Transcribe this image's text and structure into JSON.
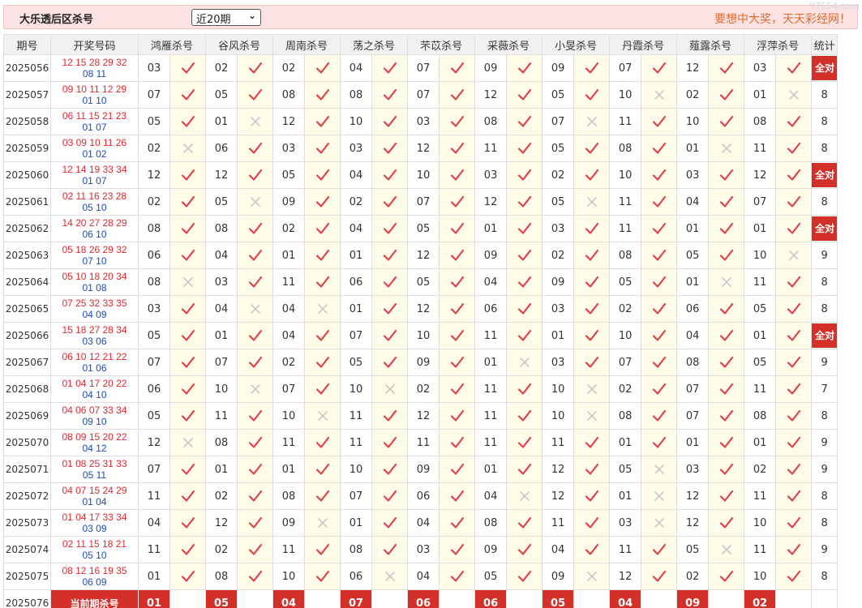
{
  "header": {
    "title": "大乐透后区杀号",
    "period_select": "近20期",
    "slogan": "要想中大奖，天天彩经网！",
    "watermark": "97654.com"
  },
  "table": {
    "columns": [
      "期号",
      "开奖号码",
      "鸿雁杀号",
      "谷风杀号",
      "周南杀号",
      "荡之杀号",
      "芣苡杀号",
      "采薇杀号",
      "小旻杀号",
      "丹霞杀号",
      "薤露杀号",
      "浮萍杀号",
      "统计"
    ],
    "full_label": "全对",
    "rows": [
      {
        "issue": "2025056",
        "red": "12 15 28 29 32",
        "blue": "08 11",
        "picks": [
          "03",
          "02",
          "02",
          "04",
          "07",
          "09",
          "09",
          "07",
          "12",
          "03"
        ],
        "hits": [
          1,
          1,
          1,
          1,
          1,
          1,
          1,
          1,
          1,
          1
        ],
        "stat": "全对"
      },
      {
        "issue": "2025057",
        "red": "09 10 11 12 29",
        "blue": "01 10",
        "picks": [
          "07",
          "05",
          "08",
          "08",
          "07",
          "12",
          "05",
          "10",
          "02",
          "01"
        ],
        "hits": [
          1,
          1,
          1,
          1,
          1,
          1,
          1,
          0,
          1,
          0
        ],
        "stat": "8"
      },
      {
        "issue": "2025058",
        "red": "06 11 15 21 23",
        "blue": "01 07",
        "picks": [
          "05",
          "01",
          "12",
          "10",
          "03",
          "08",
          "07",
          "11",
          "10",
          "08"
        ],
        "hits": [
          1,
          0,
          1,
          1,
          1,
          1,
          0,
          1,
          1,
          1
        ],
        "stat": "8"
      },
      {
        "issue": "2025059",
        "red": "03 09 10 11 26",
        "blue": "01 02",
        "picks": [
          "02",
          "06",
          "03",
          "03",
          "12",
          "11",
          "05",
          "08",
          "01",
          "11"
        ],
        "hits": [
          0,
          1,
          1,
          1,
          1,
          1,
          1,
          1,
          0,
          1
        ],
        "stat": "8"
      },
      {
        "issue": "2025060",
        "red": "12 14 19 33 34",
        "blue": "01 07",
        "picks": [
          "12",
          "12",
          "05",
          "04",
          "10",
          "03",
          "02",
          "10",
          "03",
          "12"
        ],
        "hits": [
          1,
          1,
          1,
          1,
          1,
          1,
          1,
          1,
          1,
          1
        ],
        "stat": "全对"
      },
      {
        "issue": "2025061",
        "red": "02 11 16 23 28",
        "blue": "05 10",
        "picks": [
          "02",
          "05",
          "09",
          "02",
          "07",
          "12",
          "05",
          "11",
          "04",
          "07"
        ],
        "hits": [
          1,
          0,
          1,
          1,
          1,
          1,
          0,
          1,
          1,
          1
        ],
        "stat": "8"
      },
      {
        "issue": "2025062",
        "red": "14 20 27 28 29",
        "blue": "06 10",
        "picks": [
          "08",
          "08",
          "02",
          "04",
          "05",
          "01",
          "03",
          "11",
          "01",
          "01"
        ],
        "hits": [
          1,
          1,
          1,
          1,
          1,
          1,
          1,
          1,
          1,
          1
        ],
        "stat": "全对"
      },
      {
        "issue": "2025063",
        "red": "05 18 26 29 32",
        "blue": "07 10",
        "picks": [
          "06",
          "04",
          "01",
          "01",
          "12",
          "09",
          "02",
          "08",
          "05",
          "10"
        ],
        "hits": [
          1,
          1,
          1,
          1,
          1,
          1,
          1,
          1,
          1,
          0
        ],
        "stat": "9"
      },
      {
        "issue": "2025064",
        "red": "05 10 18 20 34",
        "blue": "01 08",
        "picks": [
          "08",
          "03",
          "11",
          "06",
          "05",
          "04",
          "09",
          "05",
          "01",
          "11"
        ],
        "hits": [
          0,
          1,
          1,
          1,
          1,
          1,
          1,
          1,
          0,
          1
        ],
        "stat": "8"
      },
      {
        "issue": "2025065",
        "red": "07 25 32 33 35",
        "blue": "04 09",
        "picks": [
          "03",
          "04",
          "04",
          "01",
          "12",
          "06",
          "03",
          "02",
          "06",
          "05"
        ],
        "hits": [
          1,
          0,
          0,
          1,
          1,
          1,
          1,
          1,
          1,
          1
        ],
        "stat": "8"
      },
      {
        "issue": "2025066",
        "red": "15 18 27 28 34",
        "blue": "03 06",
        "picks": [
          "05",
          "01",
          "04",
          "07",
          "10",
          "11",
          "01",
          "10",
          "04",
          "01"
        ],
        "hits": [
          1,
          1,
          1,
          1,
          1,
          1,
          1,
          1,
          1,
          1
        ],
        "stat": "全对"
      },
      {
        "issue": "2025067",
        "red": "06 10 12 21 22",
        "blue": "01 06",
        "picks": [
          "07",
          "07",
          "02",
          "05",
          "09",
          "01",
          "03",
          "07",
          "08",
          "05"
        ],
        "hits": [
          1,
          1,
          1,
          1,
          1,
          0,
          1,
          1,
          1,
          1
        ],
        "stat": "9"
      },
      {
        "issue": "2025068",
        "red": "01 04 17 20 22",
        "blue": "04 10",
        "picks": [
          "06",
          "10",
          "07",
          "10",
          "02",
          "11",
          "10",
          "02",
          "07",
          "11"
        ],
        "hits": [
          1,
          0,
          1,
          0,
          1,
          1,
          0,
          1,
          1,
          1
        ],
        "stat": "7"
      },
      {
        "issue": "2025069",
        "red": "04 06 07 33 34",
        "blue": "09 10",
        "picks": [
          "05",
          "11",
          "10",
          "11",
          "12",
          "11",
          "10",
          "08",
          "07",
          "08"
        ],
        "hits": [
          1,
          1,
          0,
          1,
          1,
          1,
          0,
          1,
          1,
          1
        ],
        "stat": "8"
      },
      {
        "issue": "2025070",
        "red": "08 09 15 20 22",
        "blue": "04 12",
        "picks": [
          "12",
          "08",
          "11",
          "11",
          "11",
          "11",
          "11",
          "01",
          "01",
          "01"
        ],
        "hits": [
          0,
          1,
          1,
          1,
          1,
          1,
          1,
          1,
          1,
          1
        ],
        "stat": "9"
      },
      {
        "issue": "2025071",
        "red": "01 08 25 31 33",
        "blue": "05 11",
        "picks": [
          "07",
          "01",
          "01",
          "10",
          "09",
          "01",
          "12",
          "05",
          "03",
          "02"
        ],
        "hits": [
          1,
          1,
          1,
          1,
          1,
          1,
          1,
          0,
          1,
          1
        ],
        "stat": "9"
      },
      {
        "issue": "2025072",
        "red": "04 07 15 24 29",
        "blue": "01 04",
        "picks": [
          "11",
          "02",
          "08",
          "07",
          "06",
          "04",
          "12",
          "01",
          "12",
          "11"
        ],
        "hits": [
          1,
          1,
          1,
          1,
          1,
          0,
          1,
          0,
          1,
          1
        ],
        "stat": "8"
      },
      {
        "issue": "2025073",
        "red": "01 04 17 33 34",
        "blue": "03 09",
        "picks": [
          "04",
          "12",
          "09",
          "01",
          "04",
          "08",
          "11",
          "03",
          "12",
          "10"
        ],
        "hits": [
          1,
          1,
          0,
          1,
          1,
          1,
          1,
          0,
          1,
          1
        ],
        "stat": "8"
      },
      {
        "issue": "2025074",
        "red": "02 11 15 18 21",
        "blue": "05 10",
        "picks": [
          "11",
          "02",
          "11",
          "08",
          "03",
          "09",
          "04",
          "11",
          "05",
          "11"
        ],
        "hits": [
          1,
          1,
          1,
          1,
          1,
          1,
          1,
          1,
          0,
          1
        ],
        "stat": "9"
      },
      {
        "issue": "2025075",
        "red": "08 12 16 19 35",
        "blue": "06 09",
        "picks": [
          "01",
          "08",
          "10",
          "06",
          "04",
          "05",
          "09",
          "12",
          "02",
          "10"
        ],
        "hits": [
          1,
          1,
          1,
          0,
          1,
          1,
          0,
          1,
          1,
          1
        ],
        "stat": "8"
      }
    ],
    "current": {
      "issue": "2025076",
      "label": "当前期杀号",
      "picks": [
        "01",
        "05",
        "04",
        "07",
        "06",
        "06",
        "05",
        "04",
        "09",
        "02"
      ]
    }
  },
  "colors": {
    "check": "#e0404a",
    "cross": "#c8c8c8",
    "red_ball": "#e0282e",
    "blue_ball": "#1c4cb8",
    "highlight": "#d3302a"
  }
}
